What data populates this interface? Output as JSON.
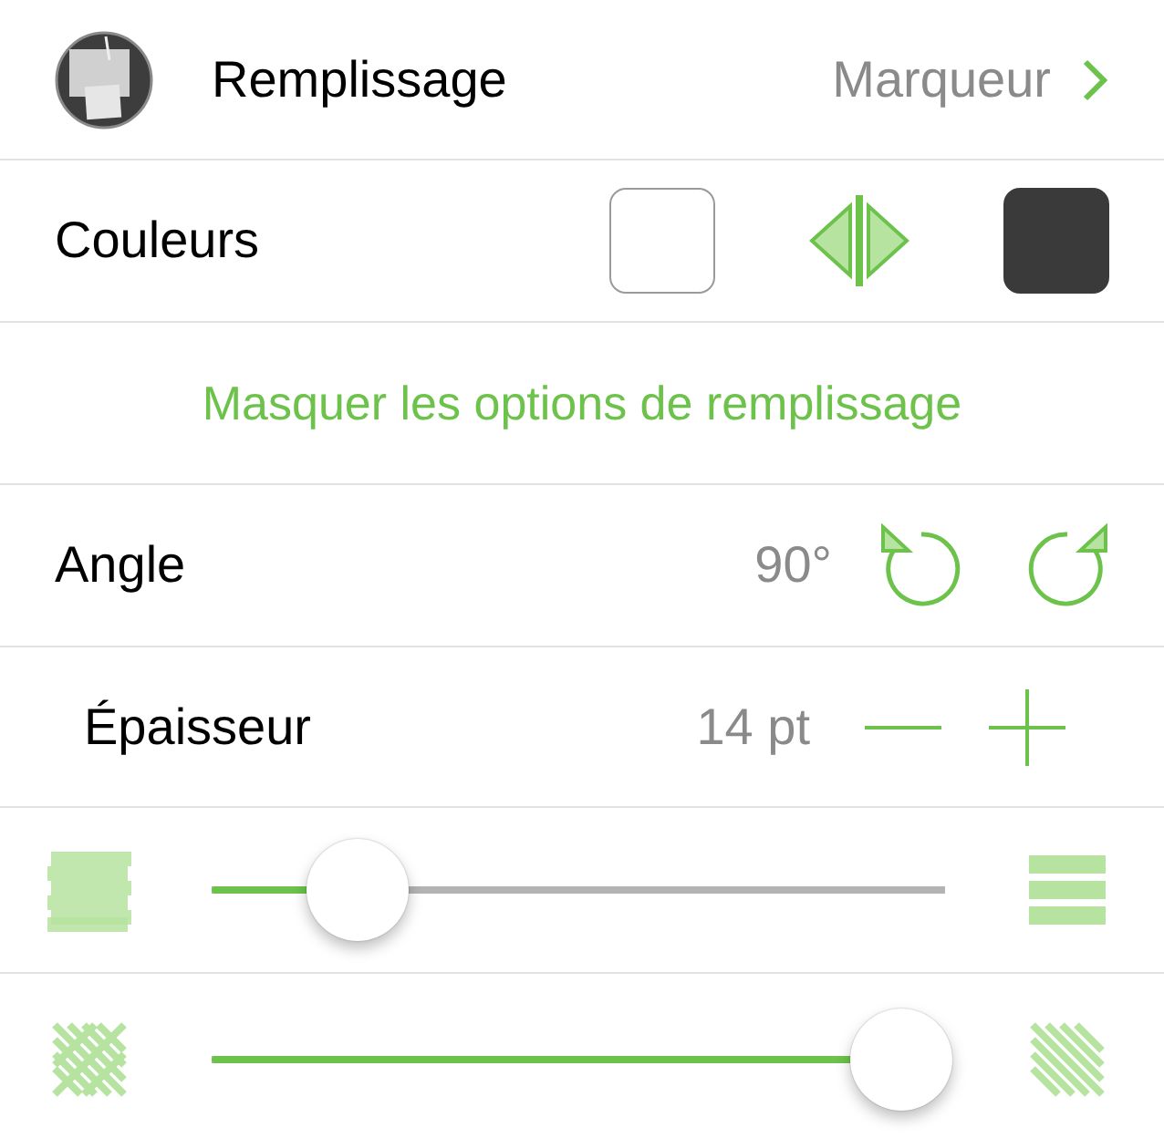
{
  "fill_row": {
    "label": "Remplissage",
    "value": "Marqueur"
  },
  "colors_row": {
    "label": "Couleurs",
    "swatches": [
      {
        "color": "#ffffff"
      },
      {
        "color": "#3a3a3a"
      }
    ]
  },
  "toggle_link": "Masquer les options de remplissage",
  "angle_row": {
    "label": "Angle",
    "value": "90°"
  },
  "thickness_row": {
    "label": "Épaisseur",
    "value": "14 pt"
  },
  "sliders": [
    {
      "kind": "density",
      "level": 0.2
    },
    {
      "kind": "hatch",
      "level": 0.94
    }
  ]
}
